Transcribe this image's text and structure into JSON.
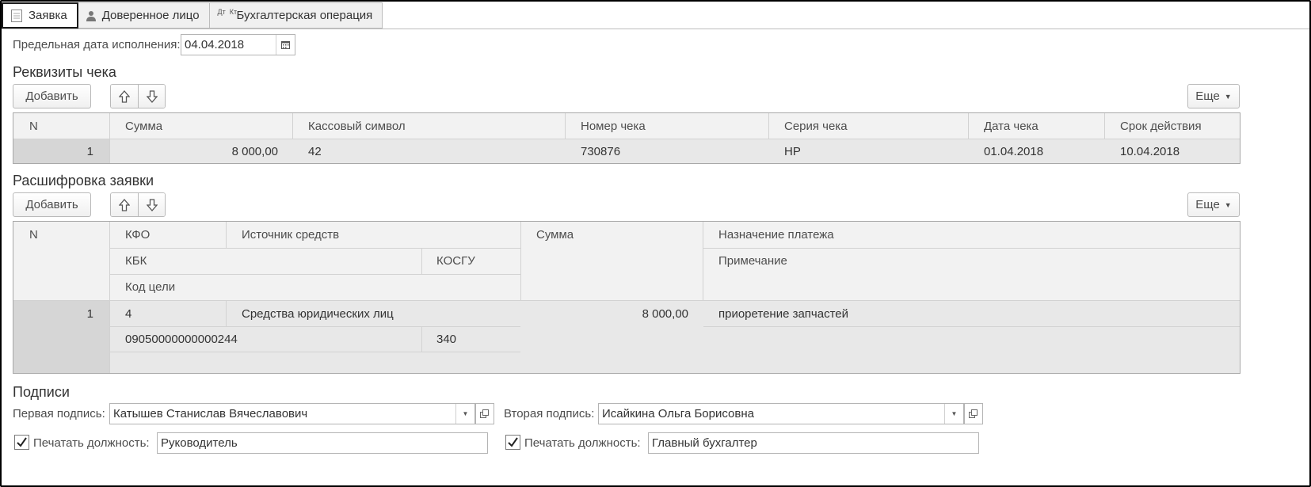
{
  "tabs": [
    {
      "label": "Заявка",
      "icon": "document-icon",
      "active": true
    },
    {
      "label": "Доверенное лицо",
      "icon": "person-icon",
      "active": false
    },
    {
      "label": "Бухгалтерская операция",
      "icon": "dt-kt-icon",
      "icon_text_top": "Дт",
      "icon_text_bottom": "Кт",
      "active": false
    }
  ],
  "deadline": {
    "label": "Предельная дата исполнения:",
    "value": "04.04.2018"
  },
  "check_details": {
    "title": "Реквизиты чека",
    "add_label": "Добавить",
    "more_label": "Еще",
    "columns": [
      "N",
      "Сумма",
      "Кассовый символ",
      "Номер чека",
      "Серия чека",
      "Дата чека",
      "Срок действия"
    ],
    "rows": [
      {
        "n": "1",
        "sum": "8 000,00",
        "cash_symbol": "42",
        "check_number": "730876",
        "check_series": "НР",
        "check_date": "01.04.2018",
        "valid_until": "10.04.2018"
      }
    ]
  },
  "breakdown": {
    "title": "Расшифровка заявки",
    "add_label": "Добавить",
    "more_label": "Еще",
    "columns": {
      "n": "N",
      "kfo": "КФО",
      "source": "Источник средств",
      "kbk": "КБК",
      "kosgu": "КОСГУ",
      "goal_code": "Код цели",
      "sum": "Сумма",
      "purpose": "Назначение платежа",
      "note": "Примечание"
    },
    "rows": [
      {
        "n": "1",
        "kfo": "4",
        "source": "Средства юридических лиц",
        "kbk": "09050000000000244",
        "kosgu": "340",
        "goal_code": "",
        "sum": "8 000,00",
        "purpose": "приоретение запчастей",
        "note": ""
      }
    ]
  },
  "signatures": {
    "title": "Подписи",
    "first_label": "Первая подпись:",
    "first_value": "Катышев Станислав Вячеславович",
    "second_label": "Вторая подпись:",
    "second_value": "Исайкина Ольга Борисовна",
    "print_position_label": "Печатать должность:",
    "first_position": "Руководитель",
    "first_print_checked": true,
    "second_position": "Главный бухгалтер",
    "second_print_checked": true
  }
}
